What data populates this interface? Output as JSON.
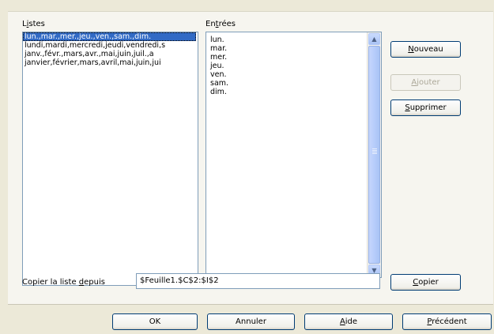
{
  "lists": {
    "label_pre": "L",
    "label_key": "i",
    "label_post": "stes",
    "items": [
      "lun.,mar.,mer.,jeu.,ven.,sam.,dim.",
      "lundi,mardi,mercredi,jeudi,vendredi,s",
      "janv.,févr.,mars,avr.,mai,juin,juil.,a",
      "janvier,février,mars,avril,mai,juin,jui"
    ]
  },
  "entries": {
    "label_pre": "En",
    "label_key": "t",
    "label_post": "rées",
    "items": [
      "lun.",
      "mar.",
      "mer.",
      "jeu.",
      "ven.",
      "sam.",
      "dim."
    ]
  },
  "buttons": {
    "nouveau": {
      "key": "N",
      "rest": "ouveau"
    },
    "ajouter": {
      "key": "A",
      "rest": "jouter"
    },
    "supprimer": {
      "key": "S",
      "rest": "upprimer"
    },
    "copier": {
      "key": "C",
      "rest": "opier"
    }
  },
  "copy_from": {
    "label_pre": "Copier la liste ",
    "label_key": "d",
    "label_post": "epuis",
    "value": "$Feuille1.$C$2:$I$2"
  },
  "footer": {
    "ok": "OK",
    "annuler": "Annuler",
    "aide": {
      "key": "A",
      "rest": "ide"
    },
    "precedent": {
      "key": "P",
      "rest": "récédent"
    }
  }
}
